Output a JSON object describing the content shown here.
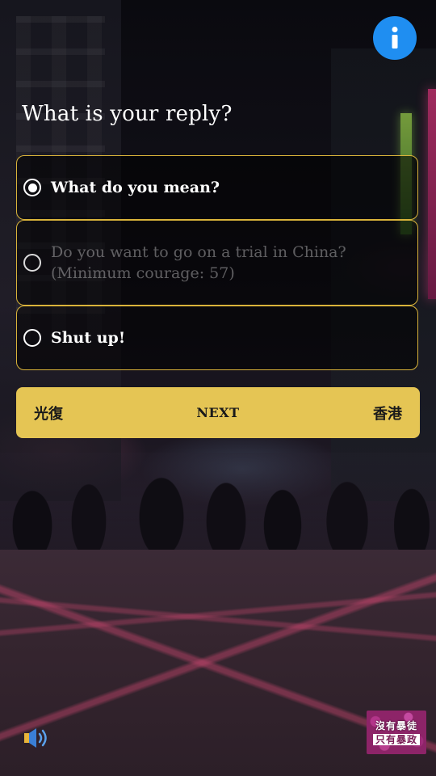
{
  "question": "What is your reply?",
  "options": [
    {
      "label": "What do you mean?",
      "selected": true,
      "enabled": true
    },
    {
      "label": "Do you want to go on a trial in China? (Minimum courage: 57)",
      "selected": false,
      "enabled": false
    },
    {
      "label": "Shut up!",
      "selected": false,
      "enabled": true
    }
  ],
  "next_button": {
    "left_text": "光復",
    "label": "NEXT",
    "right_text": "香港"
  },
  "logo": {
    "line1": "沒有暴徒",
    "line2": "只有暴政"
  },
  "icons": {
    "info": "info-icon",
    "sound": "speaker-icon",
    "radio": "radio-button-icon"
  },
  "colors": {
    "accent_yellow": "#e5c554",
    "option_border": "#d9b33a",
    "info_blue": "#1f8ef1",
    "logo_purple": "#8d2468"
  }
}
